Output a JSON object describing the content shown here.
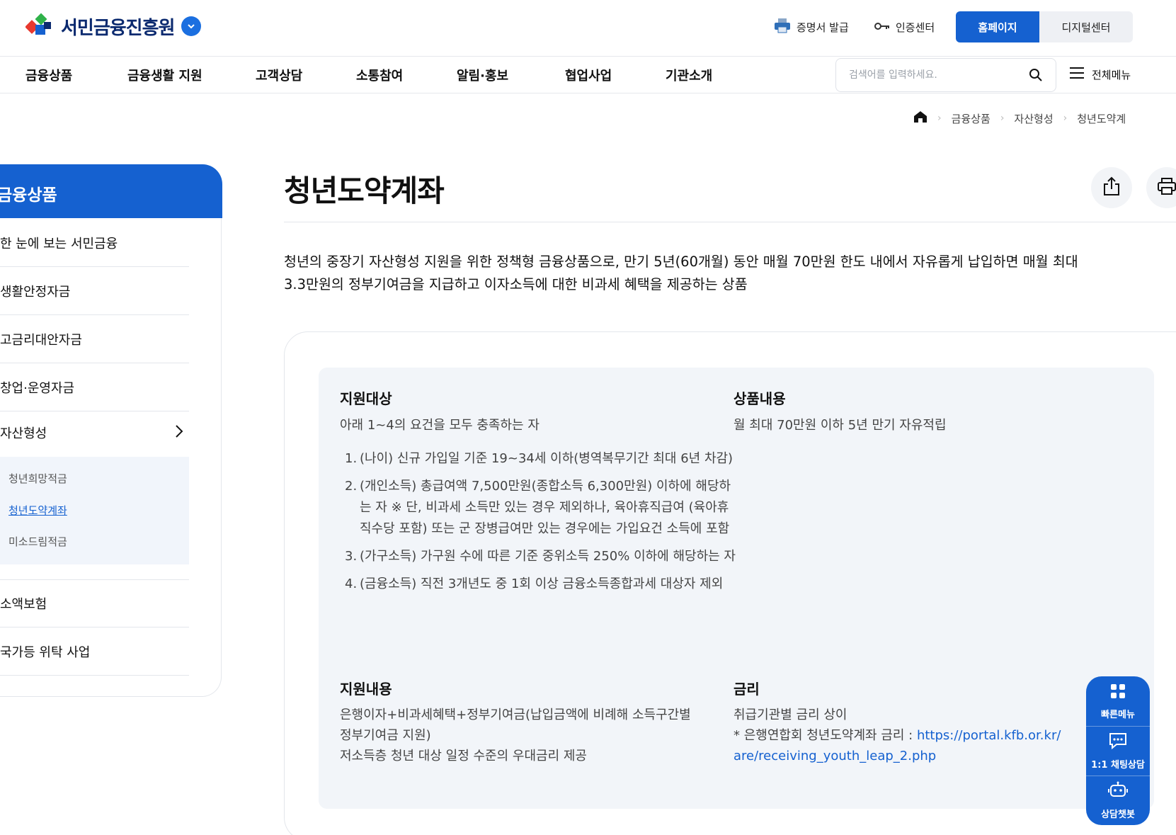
{
  "header": {
    "logo_text": "서민금융진흥원",
    "cert_label": "증명서 발급",
    "auth_label": "인증센터",
    "home_label": "홈페이지",
    "digital_label": "디지털센터"
  },
  "gnb": {
    "items": [
      "금융상품",
      "금융생활 지원",
      "고객상담",
      "소통참여",
      "알림·홍보",
      "협업사업",
      "기관소개"
    ],
    "search_placeholder": "검색어를 입력하세요.",
    "all_menu_label": "전체메뉴"
  },
  "breadcrumb": [
    "금융상품",
    "자산형성",
    "청년도약계"
  ],
  "sidebar": {
    "title": "금융상품",
    "items": [
      "한 눈에 보는 서민금융",
      "생활안정자금",
      "고금리대안자금",
      "창업·운영자금",
      "자산형성",
      "소액보험",
      "국가등 위탁 사업"
    ],
    "sub_items": [
      "청년희망적금",
      "청년도약계좌",
      "미소드림적금"
    ]
  },
  "page": {
    "title": "청년도약계좌",
    "intro_line1": "청년의 중장기 자산형성 지원을 위한 정책형 금융상품으로, 만기 5년(60개월) 동안 매월 70만원 한도 내에서 자유롭게 납입하면 매월 최대",
    "intro_line2": "3.3만원의 정부기여금을 지급하고 이자소득에 대한 비과세 혜택을 제공하는 상품"
  },
  "support_target": {
    "title": "지원대상",
    "desc": "아래 1~4의 요건을 모두 충족하는 자",
    "reqs": [
      {
        "num": "1.",
        "text": "(나이) 신규 가입일 기준 19~34세 이하(병역복무기간 최대 6년 차감)"
      },
      {
        "num": "2.",
        "text": "(개인소득) 총급여액 7,500만원(종합소득 6,300만원) 이하에 해당하는 자 ※ 단, 비과세 소득만 있는 경우 제외하나, 육아휴직급여 (육아휴직수당 포함) 또는 군 장병급여만 있는 경우에는 가입요건 소득에 포함"
      },
      {
        "num": "3.",
        "text": "(가구소득) 가구원 수에 따른 기준 중위소득 250% 이하에 해당하는 자"
      },
      {
        "num": "4.",
        "text": "(금융소득) 직전 3개년도 중 1회 이상 금융소득종합과세 대상자 제외"
      }
    ]
  },
  "product_content": {
    "title": "상품내용",
    "desc": "월 최대 70만원 이하 5년 만기 자유적립"
  },
  "support_content": {
    "title": "지원내용",
    "line1": "은행이자+비과세혜택+정부기여금(납입금액에 비례해 소득구간별",
    "line2": "정부기여금 지원)",
    "line3": "저소득층 청년 대상 일정 수준의 우대금리 제공"
  },
  "rate": {
    "title": "금리",
    "line1": "취급기관별 금리 상이",
    "line2_prefix": "* 은행연합회 청년도약계좌 금리 : ",
    "link_part1": "https://portal.kfb.or.kr/",
    "link_part2": "are/receiving_youth_leap_2.php"
  },
  "quick_menu": {
    "quick_label": "빠른메뉴",
    "chat_label": "1:1 채팅상담",
    "bot_label": "상담챗봇"
  },
  "colors": {
    "primary": "#1561d0",
    "navy": "#0b2a6f",
    "panel_bg": "#f2f5f9"
  }
}
